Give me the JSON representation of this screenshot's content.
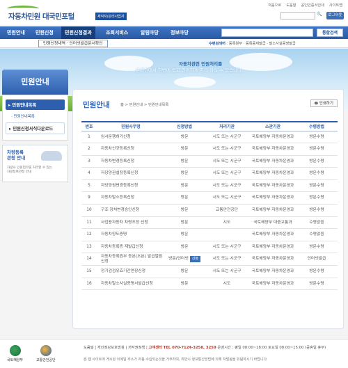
{
  "header": {
    "logo_text": "자동차민원 대국민포털",
    "logo_badge": "제작자/관리사업자",
    "top_links": [
      "처음으로",
      "도움말",
      "공인인증서안내",
      "사이트맵"
    ],
    "search_icon": "search-icon",
    "login_label": "로그아웃"
  },
  "gnb": {
    "items": [
      "민원안내",
      "민원신청",
      "민원신청결과",
      "조회서비스",
      "알림마당",
      "정보마당"
    ],
    "search_button": "통합검색"
  },
  "subnav": {
    "box_label": "민원신청내역 · 인터넷발급문서확인",
    "right_label": "수련검색어",
    "right_text": ": 등록원부 · 등록증재발급 · 말소사실증명발급"
  },
  "banner": {
    "line1": "자동차관련 민원처리를",
    "line2": "온라인에서 한번에 쉽고 간편하게 처리 하실 수 있습니다."
  },
  "lnb": {
    "title": "민원안내",
    "items": [
      "민원안내목록",
      "민원인내목록",
      "민원신청서식다운로드"
    ],
    "ad_title1": "차량등록",
    "ad_title2": "관청 안내",
    "ad_desc1": "차량사 인원업무를 처리할 수 있는",
    "ad_desc2": "차량등록관청 안내"
  },
  "content": {
    "title": "민원안내",
    "breadcrumb": "홈 > 민원안내 > 민원안내목록",
    "print_label": "인쇄하기",
    "columns": [
      "번호",
      "민원사무명",
      "신청방법",
      "처리기관",
      "소관기관",
      "수령방법"
    ],
    "rows": [
      {
        "no": "1",
        "name": "임시운행허가신청",
        "method": "방문",
        "org": "시도 또는 시군구",
        "owner": "국토해양부 자동차운영과",
        "receive": "방문수령"
      },
      {
        "no": "2",
        "name": "자동차신규등록신청",
        "method": "방문",
        "org": "시도 또는 시군구",
        "owner": "국토해양부 자동차운영과",
        "receive": "방문수령"
      },
      {
        "no": "3",
        "name": "자동차변경등록신청",
        "method": "방문",
        "org": "시도 또는 시군구",
        "owner": "국토해양부 자동차운영과",
        "receive": "방문수령"
      },
      {
        "no": "4",
        "name": "자당양권설정등록신청",
        "method": "방문",
        "org": "시도 또는 시군구",
        "owner": "국토해양부 자동차운영과",
        "receive": "방문수령"
      },
      {
        "no": "5",
        "name": "자당양권변경등록신청",
        "method": "방문",
        "org": "시도 또는 시군구",
        "owner": "국토해양부 자동차운영과",
        "receive": "방문수령"
      },
      {
        "no": "9",
        "name": "자동차말소등록신청",
        "method": "방문",
        "org": "시도 또는 시군구",
        "owner": "국토해양부 자동차운영과",
        "receive": "방문수령"
      },
      {
        "no": "10",
        "name": "구조·장치변경승인신청",
        "method": "방문",
        "org": "교통안전공단",
        "owner": "국토해양부 자동차운영과",
        "receive": "방문수령"
      },
      {
        "no": "11",
        "name": "사업용자동차 차령조정 신청",
        "method": "방문",
        "org": "시도",
        "owner": "국토해양부 대중교통과",
        "receive": "수령없음"
      },
      {
        "no": "12",
        "name": "자동차양도증명",
        "method": "방문",
        "org": "",
        "owner": "국토해양부 자동차운영과",
        "receive": "수령없음"
      },
      {
        "no": "13",
        "name": "자동차등록증 재발급신청",
        "method": "방문",
        "org": "시도 또는 시군구",
        "owner": "국토해양부 자동차운영과",
        "receive": "방문수령"
      },
      {
        "no": "14",
        "name": "자동차등록원부 등본(초본) 발급열람신청",
        "method": "방문/인터넷",
        "tag": "신청",
        "org": "시도 또는 시군구",
        "owner": "국토해양부 자동차운영과",
        "receive": "인터넷발급"
      },
      {
        "no": "15",
        "name": "정기검검유효기간연장신청",
        "method": "방문",
        "org": "시도 또는 시군구",
        "owner": "국토해양부 자동차운영과",
        "receive": "방문수령"
      },
      {
        "no": "16",
        "name": "자동차말소사실증명서발급신청",
        "method": "방문",
        "org": "시도",
        "owner": "국토해양부 자동차운영과",
        "receive": "방문수령"
      }
    ]
  },
  "footer": {
    "logo1": "국토해양부",
    "logo2": "교통안전공단",
    "links": [
      "도움말",
      "개인정보보호방침",
      "저작권정책"
    ],
    "contact_label": "고객센터",
    "contact": "TEL 070-7124-3258, 3259",
    "hours": "운영시간 : 평일 08:00~18:00 토요일 08:00~15:00 (공휴일 휴무)",
    "copyright": "본 웹 사이트에 게시된 이메일 주소가 자동 수집되는것을 거부하며, 위반시 정보통신망법에 의해 처벌됨을 유념하시기 바랍니다."
  },
  "colors": {
    "primary": "#2d5fae",
    "nav": "#3e74c4",
    "accent": "#6fb83f"
  }
}
